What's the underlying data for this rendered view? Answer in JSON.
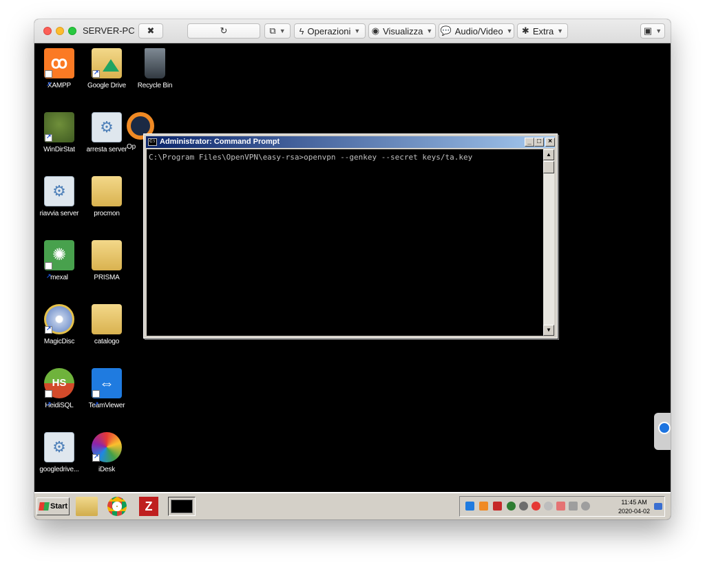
{
  "window": {
    "title": "SERVER-PC"
  },
  "toolbar": {
    "operations": "Operazioni",
    "view": "Visualizza",
    "audio_video": "Audio/Video",
    "extra": "Extra"
  },
  "desktop_icons": [
    {
      "label": "XAMPP",
      "icon": "xampp-icon"
    },
    {
      "label": "Google Drive",
      "icon": "google-drive-icon"
    },
    {
      "label": "Recycle Bin",
      "icon": "recycle-bin-icon"
    },
    {
      "label": "WinDirStat",
      "icon": "windirstat-icon"
    },
    {
      "label": "arresta server",
      "icon": "gear-icon"
    },
    {
      "label": "Op",
      "icon": "openvpn-icon"
    },
    {
      "label": "riavvia server",
      "icon": "gear-icon"
    },
    {
      "label": "procmon",
      "icon": "folder-icon"
    },
    {
      "label": "mexal",
      "icon": "mexal-icon"
    },
    {
      "label": "PRISMA",
      "icon": "folder-icon"
    },
    {
      "label": "MagicDisc",
      "icon": "magicdisc-icon"
    },
    {
      "label": "catalogo",
      "icon": "folder-icon"
    },
    {
      "label": "HeidiSQL",
      "icon": "heidisql-icon"
    },
    {
      "label": "TeamViewer",
      "icon": "teamviewer-icon"
    },
    {
      "label": "googledrive...",
      "icon": "gear-icon"
    },
    {
      "label": "iDesk",
      "icon": "idesk-icon"
    }
  ],
  "cmd": {
    "title": "Administrator: Command Prompt",
    "line": "C:\\Program Files\\OpenVPN\\easy-rsa>openvpn --genkey --secret keys/ta.key"
  },
  "taskbar": {
    "start_label": "Start",
    "clock_time": "11:45 AM",
    "clock_date": "2020-04-02"
  },
  "colors": {
    "desktop": "#000000",
    "cmd_title_start": "#0a246a",
    "cmd_title_end": "#a6caf0",
    "taskbar": "#d4d0c8"
  }
}
